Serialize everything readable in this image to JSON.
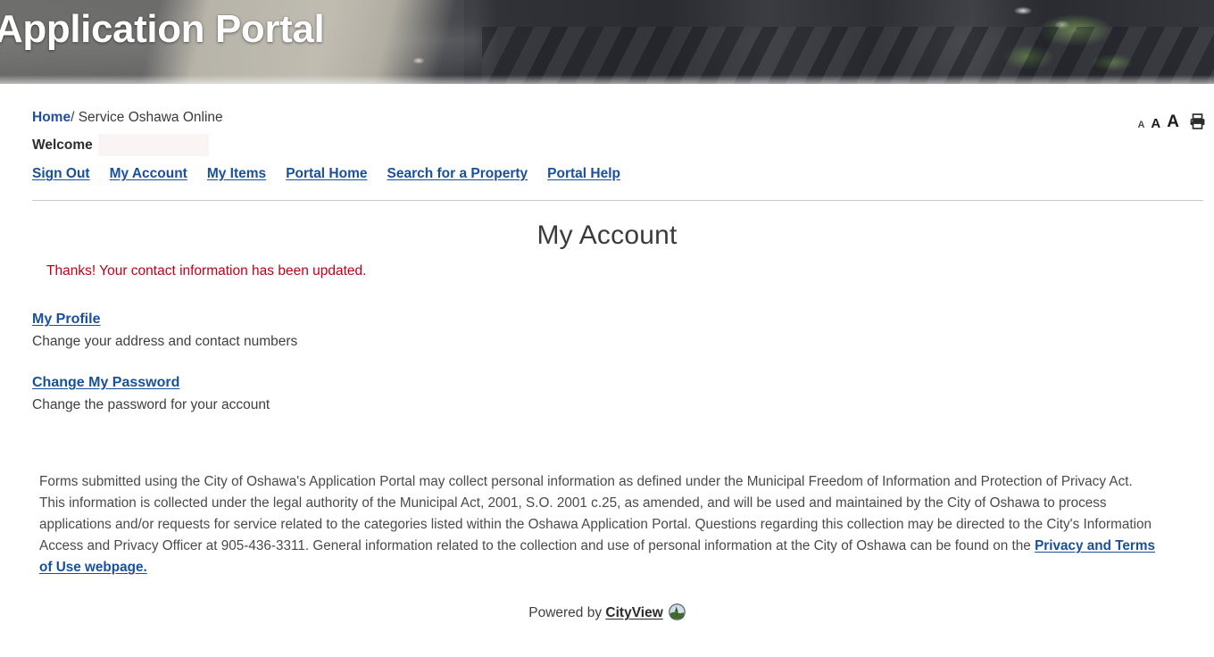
{
  "banner": {
    "title": "Application Portal",
    "image_description": "aerial-photo-of-townhouse-rooftops"
  },
  "breadcrumb": {
    "home_label": "Home",
    "separator": "/",
    "current_label": "Service Oshawa Online"
  },
  "tools": {
    "font_small_label": "A",
    "font_medium_label": "A",
    "font_large_label": "A",
    "print_icon": "printer-icon"
  },
  "welcome": {
    "label": "Welcome",
    "user_name": ""
  },
  "portal_nav": {
    "items": [
      {
        "label": "Sign Out"
      },
      {
        "label": "My Account"
      },
      {
        "label": "My Items"
      },
      {
        "label": "Portal Home"
      },
      {
        "label": "Search for a Property"
      },
      {
        "label": "Portal Help"
      }
    ]
  },
  "main": {
    "page_title": "My Account",
    "flash_message": "Thanks! Your contact information has been updated.",
    "flash_color": "#c00017",
    "account_options": [
      {
        "link_label": "My Profile",
        "description": "Change your address and contact numbers"
      },
      {
        "link_label": "Change My Password",
        "description": "Change the password for your account"
      }
    ]
  },
  "privacy": {
    "text_before_link": "Forms submitted using the City of Oshawa's Application Portal may collect personal information as defined under the Municipal Freedom of Information and Protection of Privacy Act. This information is collected under the legal authority of the Municipal Act, 2001, S.O. 2001 c.25, as amended, and will be used and maintained by the City of Oshawa to process applications and/or requests for service related to the categories listed within the Oshawa Application Portal. Questions regarding this collection may be directed to the City's Information Access and Privacy Officer at 905-436-3311. General information related to the collection and use of personal information at the City of Oshawa can be found on the ",
    "link_label": "Privacy and Terms of Use webpage.",
    "phone": "905-436-3311"
  },
  "footer": {
    "powered_by_text": "Powered by",
    "brand_label": "CityView",
    "brand_logo": "cityview-globe-icon"
  },
  "colors": {
    "link_blue": "#19509c",
    "breadcrumb_blue": "#1f4e9c",
    "flash_red": "#c00017",
    "body_text": "#3f3f3f",
    "divider": "#c9c9c9"
  }
}
